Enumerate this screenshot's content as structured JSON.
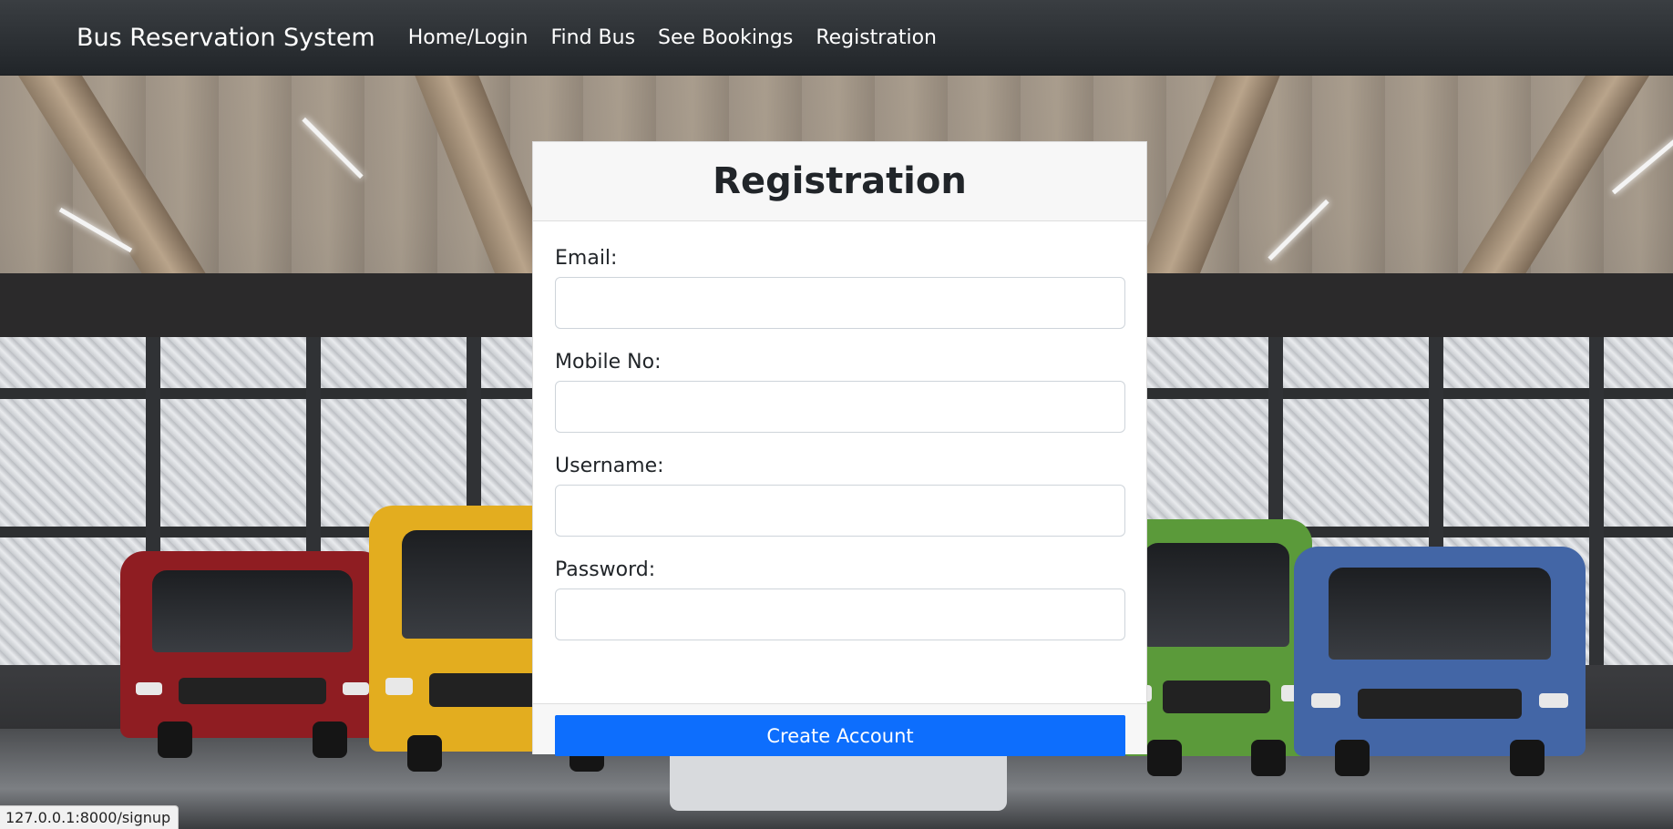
{
  "navbar": {
    "brand": "Bus Reservation System",
    "links": [
      "Home/Login",
      "Find Bus",
      "See Bookings",
      "Registration"
    ]
  },
  "card": {
    "title": "Registration",
    "fields": [
      {
        "label": "Email:",
        "value": "",
        "type": "email"
      },
      {
        "label": "Mobile No:",
        "value": "",
        "type": "tel"
      },
      {
        "label": "Username:",
        "value": "",
        "type": "text"
      },
      {
        "label": "Password:",
        "value": "",
        "type": "password"
      }
    ],
    "submit_label": "Create Account"
  },
  "status_bar": {
    "url": "127.0.0.1:8000/signup"
  },
  "colors": {
    "navbar": "#212529",
    "primary": "#0d6efd",
    "card_header": "#f7f7f7"
  }
}
